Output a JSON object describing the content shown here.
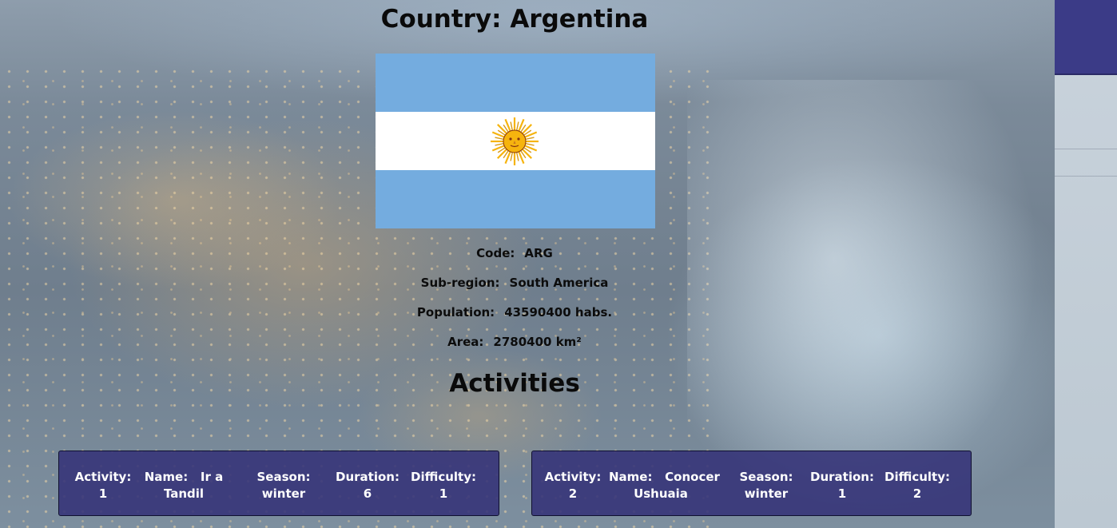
{
  "country": {
    "title": "Country: Argentina",
    "flag_icon": "argentina-flag",
    "code_label": "Code:",
    "code": "ARG",
    "subregion_label": "Sub-region:",
    "subregion": "South America",
    "population_label": "Population:",
    "population": "43590400 habs.",
    "area_label": "Area:",
    "area": "2780400 km²"
  },
  "activities": {
    "heading": "Activities",
    "labels": {
      "activity": "Activity:",
      "name": "Name:",
      "season": "Season:",
      "duration": "Duration:",
      "difficulty": "Difficulty:"
    },
    "items": [
      {
        "activity": "1",
        "name_line1": "Ir a",
        "name_line2": "Tandil",
        "season": "winter",
        "duration": "6",
        "difficulty": "1"
      },
      {
        "activity": "2",
        "name_line1": "Conocer",
        "name_line2": "Ushuaia",
        "season": "winter",
        "duration": "1",
        "difficulty": "2"
      }
    ]
  },
  "colors": {
    "card_bg": "#34327a",
    "nav_block": "#3b3b87",
    "flag_blue": "#74acdf",
    "sun": "#f6b40e"
  }
}
